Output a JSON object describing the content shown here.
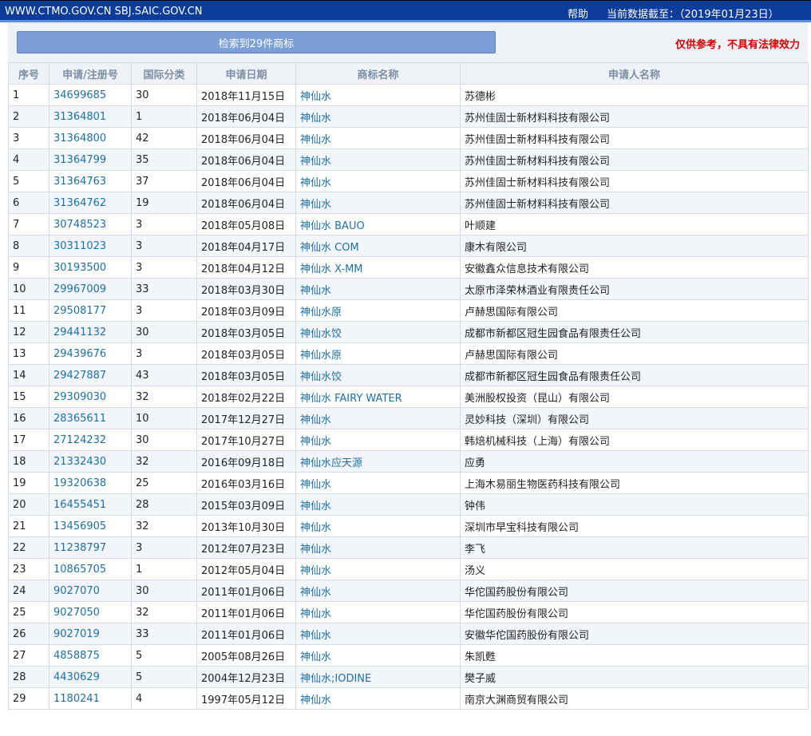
{
  "header": {
    "domains": "WWW.CTMO.GOV.CN SBJ.SAIC.GOV.CN",
    "help_label": "帮助",
    "data_as_of": "当前数据截至：（2019年01月23日）"
  },
  "summary": {
    "result_button_label": "检索到29件商标",
    "disclaimer": "仅供参考，不具有法律效力"
  },
  "table": {
    "headers": [
      "序号",
      "申请/注册号",
      "国际分类",
      "申请日期",
      "商标名称",
      "申请人名称"
    ],
    "rows": [
      [
        "1",
        "34699685",
        "30",
        "2018年11月15日",
        "神仙水",
        "苏德彬"
      ],
      [
        "2",
        "31364801",
        "1",
        "2018年06月04日",
        "神仙水",
        "苏州佳固士新材料科技有限公司"
      ],
      [
        "3",
        "31364800",
        "42",
        "2018年06月04日",
        "神仙水",
        "苏州佳固士新材料科技有限公司"
      ],
      [
        "4",
        "31364799",
        "35",
        "2018年06月04日",
        "神仙水",
        "苏州佳固士新材料科技有限公司"
      ],
      [
        "5",
        "31364763",
        "37",
        "2018年06月04日",
        "神仙水",
        "苏州佳固士新材料科技有限公司"
      ],
      [
        "6",
        "31364762",
        "19",
        "2018年06月04日",
        "神仙水",
        "苏州佳固士新材料科技有限公司"
      ],
      [
        "7",
        "30748523",
        "3",
        "2018年05月08日",
        "神仙水 BAUO",
        "叶顺建"
      ],
      [
        "8",
        "30311023",
        "3",
        "2018年04月17日",
        "神仙水 COM",
        "康木有限公司"
      ],
      [
        "9",
        "30193500",
        "3",
        "2018年04月12日",
        "神仙水 X-MM",
        "安徽鑫众信息技术有限公司"
      ],
      [
        "10",
        "29967009",
        "33",
        "2018年03月30日",
        "神仙水",
        "太原市泽荣林酒业有限责任公司"
      ],
      [
        "11",
        "29508177",
        "3",
        "2018年03月09日",
        "神仙水原",
        "卢赫思国际有限公司"
      ],
      [
        "12",
        "29441132",
        "30",
        "2018年03月05日",
        "神仙水饺",
        "成都市新都区冠生园食品有限责任公司"
      ],
      [
        "13",
        "29439676",
        "3",
        "2018年03月05日",
        "神仙水原",
        "卢赫思国际有限公司"
      ],
      [
        "14",
        "29427887",
        "43",
        "2018年03月05日",
        "神仙水饺",
        "成都市新都区冠生园食品有限责任公司"
      ],
      [
        "15",
        "29309030",
        "32",
        "2018年02月22日",
        "神仙水 FAIRY WATER",
        "美洲股权投资（昆山）有限公司"
      ],
      [
        "16",
        "28365611",
        "10",
        "2017年12月27日",
        "神仙水",
        "灵妙科技（深圳）有限公司"
      ],
      [
        "17",
        "27124232",
        "30",
        "2017年10月27日",
        "神仙水",
        "韩焙机械科技（上海）有限公司"
      ],
      [
        "18",
        "21332430",
        "32",
        "2016年09月18日",
        "神仙水应天源",
        "应勇"
      ],
      [
        "19",
        "19320638",
        "25",
        "2016年03月16日",
        "神仙水",
        "上海木易丽生物医药科技有限公司"
      ],
      [
        "20",
        "16455451",
        "28",
        "2015年03月09日",
        "神仙水",
        "钟伟"
      ],
      [
        "21",
        "13456905",
        "32",
        "2013年10月30日",
        "神仙水",
        "深圳市早宝科技有限公司"
      ],
      [
        "22",
        "11238797",
        "3",
        "2012年07月23日",
        "神仙水",
        "李飞"
      ],
      [
        "23",
        "10865705",
        "1",
        "2012年05月04日",
        "神仙水",
        "汤义"
      ],
      [
        "24",
        "9027070",
        "30",
        "2011年01月06日",
        "神仙水",
        "华佗国药股份有限公司"
      ],
      [
        "25",
        "9027050",
        "32",
        "2011年01月06日",
        "神仙水",
        "华佗国药股份有限公司"
      ],
      [
        "26",
        "9027019",
        "33",
        "2011年01月06日",
        "神仙水",
        "安徽华佗国药股份有限公司"
      ],
      [
        "27",
        "4858875",
        "5",
        "2005年08月26日",
        "神仙水",
        "朱凯甦"
      ],
      [
        "28",
        "4430629",
        "5",
        "2004年12月23日",
        "神仙水;IODINE",
        "樊子威"
      ],
      [
        "29",
        "1180241",
        "4",
        "1997年05月12日",
        "神仙水",
        "南京大渊商贸有限公司"
      ]
    ]
  }
}
